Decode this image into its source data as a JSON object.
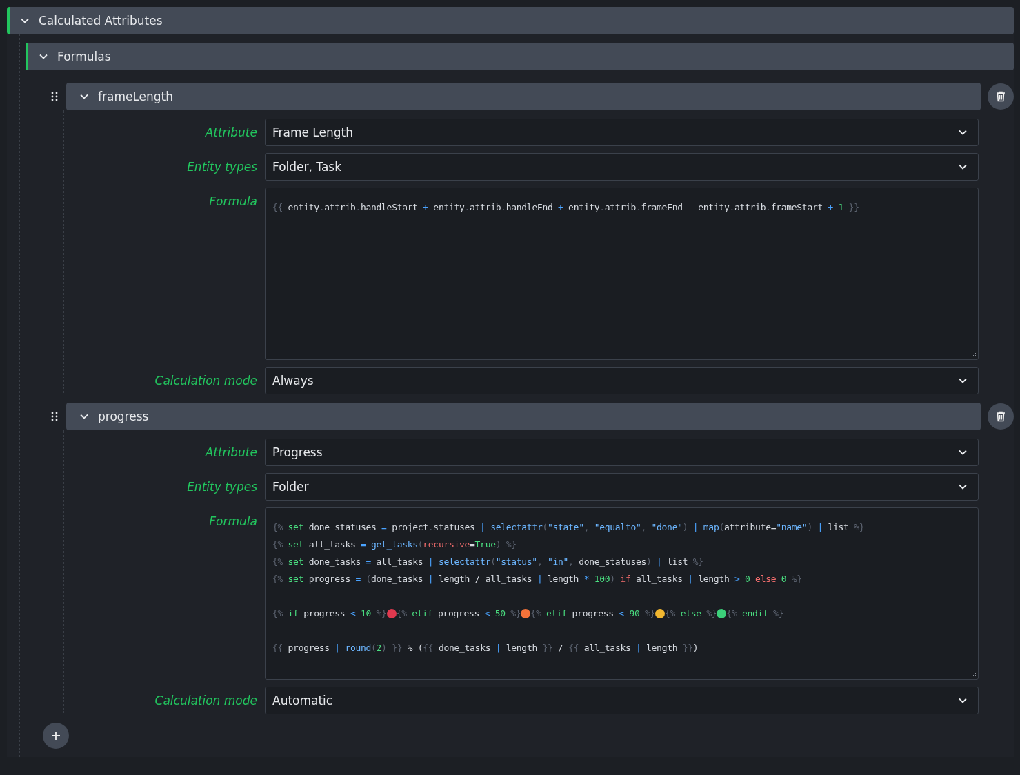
{
  "section": {
    "title": "Calculated Attributes",
    "expanded": true
  },
  "group": {
    "title": "Formulas",
    "expanded": true
  },
  "items": [
    {
      "name": "frameLength",
      "expanded": true,
      "fields": [
        {
          "label": "Attribute",
          "kind": "select",
          "value": "Frame Length"
        },
        {
          "label": "Entity types",
          "kind": "select",
          "value": "Folder, Task"
        },
        {
          "label": "Formula",
          "kind": "code",
          "lines": [
            {
              "space_before": false,
              "tokens": [
                {
                  "text": "{{",
                  "kind": "d"
                },
                {
                  "text": " entity",
                  "kind": "n"
                },
                {
                  "text": ".",
                  "kind": "d"
                },
                {
                  "text": "attrib",
                  "kind": "n"
                },
                {
                  "text": ".",
                  "kind": "d"
                },
                {
                  "text": "handleStart ",
                  "kind": "n"
                },
                {
                  "text": "+",
                  "kind": "o"
                },
                {
                  "text": " entity",
                  "kind": "n"
                },
                {
                  "text": ".",
                  "kind": "d"
                },
                {
                  "text": "attrib",
                  "kind": "n"
                },
                {
                  "text": ".",
                  "kind": "d"
                },
                {
                  "text": "handleEnd ",
                  "kind": "n"
                },
                {
                  "text": "+",
                  "kind": "o"
                },
                {
                  "text": " entity",
                  "kind": "n"
                },
                {
                  "text": ".",
                  "kind": "d"
                },
                {
                  "text": "attrib",
                  "kind": "n"
                },
                {
                  "text": ".",
                  "kind": "d"
                },
                {
                  "text": "frameEnd ",
                  "kind": "n"
                },
                {
                  "text": "-",
                  "kind": "o"
                },
                {
                  "text": " entity",
                  "kind": "n"
                },
                {
                  "text": ".",
                  "kind": "d"
                },
                {
                  "text": "attrib",
                  "kind": "n"
                },
                {
                  "text": ".",
                  "kind": "d"
                },
                {
                  "text": "frameStart ",
                  "kind": "n"
                },
                {
                  "text": "+",
                  "kind": "o"
                },
                {
                  "text": " 1",
                  "kind": "num"
                },
                {
                  "text": " }}",
                  "kind": "d"
                }
              ]
            }
          ]
        },
        {
          "label": "Calculation mode",
          "kind": "select",
          "value": "Always"
        }
      ]
    },
    {
      "name": "progress",
      "expanded": true,
      "fields": [
        {
          "label": "Attribute",
          "kind": "select",
          "value": "Progress"
        },
        {
          "label": "Entity types",
          "kind": "select",
          "value": "Folder"
        },
        {
          "label": "Formula",
          "kind": "code",
          "lines": [
            {
              "space_before": false,
              "tokens": [
                {
                  "text": "{%",
                  "kind": "d"
                },
                {
                  "text": " set",
                  "kind": "kw"
                },
                {
                  "text": " done_statuses ",
                  "kind": "n"
                },
                {
                  "text": "=",
                  "kind": "o"
                },
                {
                  "text": " project",
                  "kind": "n"
                },
                {
                  "text": ".",
                  "kind": "d"
                },
                {
                  "text": "statuses ",
                  "kind": "n"
                },
                {
                  "text": "|",
                  "kind": "o"
                },
                {
                  "text": " selectattr",
                  "kind": "f"
                },
                {
                  "text": "(",
                  "kind": "d"
                },
                {
                  "text": "\"state\"",
                  "kind": "s"
                },
                {
                  "text": ", ",
                  "kind": "d"
                },
                {
                  "text": "\"equalto\"",
                  "kind": "s"
                },
                {
                  "text": ", ",
                  "kind": "d"
                },
                {
                  "text": "\"done\"",
                  "kind": "s"
                },
                {
                  "text": ")",
                  "kind": "d"
                },
                {
                  "text": " | ",
                  "kind": "o"
                },
                {
                  "text": "map",
                  "kind": "f"
                },
                {
                  "text": "(",
                  "kind": "d"
                },
                {
                  "text": "attribute=",
                  "kind": "n"
                },
                {
                  "text": "\"name\"",
                  "kind": "s"
                },
                {
                  "text": ")",
                  "kind": "d"
                },
                {
                  "text": " | ",
                  "kind": "o"
                },
                {
                  "text": "list",
                  "kind": "n"
                },
                {
                  "text": " %}",
                  "kind": "d"
                }
              ]
            },
            {
              "space_before": false,
              "tokens": [
                {
                  "text": "{%",
                  "kind": "d"
                },
                {
                  "text": " set",
                  "kind": "kw"
                },
                {
                  "text": " all_tasks ",
                  "kind": "n"
                },
                {
                  "text": "=",
                  "kind": "o"
                },
                {
                  "text": " get_tasks",
                  "kind": "f"
                },
                {
                  "text": "(",
                  "kind": "d"
                },
                {
                  "text": "recursive",
                  "kind": "alt"
                },
                {
                  "text": "=",
                  "kind": "n"
                },
                {
                  "text": "True",
                  "kind": "kw"
                },
                {
                  "text": ")",
                  "kind": "d"
                },
                {
                  "text": " %}",
                  "kind": "d"
                }
              ]
            },
            {
              "space_before": false,
              "tokens": [
                {
                  "text": "{%",
                  "kind": "d"
                },
                {
                  "text": " set",
                  "kind": "kw"
                },
                {
                  "text": " done_tasks ",
                  "kind": "n"
                },
                {
                  "text": "=",
                  "kind": "o"
                },
                {
                  "text": " all_tasks ",
                  "kind": "n"
                },
                {
                  "text": "|",
                  "kind": "o"
                },
                {
                  "text": " selectattr",
                  "kind": "f"
                },
                {
                  "text": "(",
                  "kind": "d"
                },
                {
                  "text": "\"status\"",
                  "kind": "s"
                },
                {
                  "text": ", ",
                  "kind": "d"
                },
                {
                  "text": "\"in\"",
                  "kind": "s"
                },
                {
                  "text": ", ",
                  "kind": "d"
                },
                {
                  "text": "done_statuses",
                  "kind": "n"
                },
                {
                  "text": ")",
                  "kind": "d"
                },
                {
                  "text": " | ",
                  "kind": "o"
                },
                {
                  "text": "list",
                  "kind": "n"
                },
                {
                  "text": " %}",
                  "kind": "d"
                }
              ]
            },
            {
              "space_before": false,
              "tokens": [
                {
                  "text": "{%",
                  "kind": "d"
                },
                {
                  "text": " set",
                  "kind": "kw"
                },
                {
                  "text": " progress ",
                  "kind": "n"
                },
                {
                  "text": "=",
                  "kind": "o"
                },
                {
                  "text": " (",
                  "kind": "d"
                },
                {
                  "text": "done_tasks ",
                  "kind": "n"
                },
                {
                  "text": "|",
                  "kind": "o"
                },
                {
                  "text": " length / all_tasks ",
                  "kind": "n"
                },
                {
                  "text": "|",
                  "kind": "o"
                },
                {
                  "text": " length ",
                  "kind": "n"
                },
                {
                  "text": "*",
                  "kind": "o"
                },
                {
                  "text": " 100",
                  "kind": "num"
                },
                {
                  "text": ")",
                  "kind": "d"
                },
                {
                  "text": " if",
                  "kind": "alt"
                },
                {
                  "text": " all_tasks ",
                  "kind": "n"
                },
                {
                  "text": "|",
                  "kind": "o"
                },
                {
                  "text": " length ",
                  "kind": "n"
                },
                {
                  "text": ">",
                  "kind": "o"
                },
                {
                  "text": " 0",
                  "kind": "num"
                },
                {
                  "text": " else",
                  "kind": "alt"
                },
                {
                  "text": " 0",
                  "kind": "num"
                },
                {
                  "text": " %}",
                  "kind": "d"
                }
              ]
            },
            {
              "space_before": true,
              "tokens": [
                {
                  "text": "{%",
                  "kind": "d"
                },
                {
                  "text": " if",
                  "kind": "kw"
                },
                {
                  "text": " progress ",
                  "kind": "n"
                },
                {
                  "text": "<",
                  "kind": "o"
                },
                {
                  "text": " 10",
                  "kind": "num"
                },
                {
                  "text": " %}",
                  "kind": "d"
                },
                {
                  "kind": "dot",
                  "color": "#e0394f"
                },
                {
                  "text": "{%",
                  "kind": "d"
                },
                {
                  "text": " elif",
                  "kind": "kw"
                },
                {
                  "text": " progress ",
                  "kind": "n"
                },
                {
                  "text": "<",
                  "kind": "o"
                },
                {
                  "text": " 50",
                  "kind": "num"
                },
                {
                  "text": " %}",
                  "kind": "d"
                },
                {
                  "kind": "dot",
                  "color": "#f5733a"
                },
                {
                  "text": "{%",
                  "kind": "d"
                },
                {
                  "text": " elif",
                  "kind": "kw"
                },
                {
                  "text": " progress ",
                  "kind": "n"
                },
                {
                  "text": "<",
                  "kind": "o"
                },
                {
                  "text": " 90",
                  "kind": "num"
                },
                {
                  "text": " %}",
                  "kind": "d"
                },
                {
                  "kind": "dot",
                  "color": "#f2b730"
                },
                {
                  "text": "{%",
                  "kind": "d"
                },
                {
                  "text": " else",
                  "kind": "kw"
                },
                {
                  "text": " %}",
                  "kind": "d"
                },
                {
                  "kind": "dot",
                  "color": "#3ccf7a"
                },
                {
                  "text": "{%",
                  "kind": "d"
                },
                {
                  "text": " endif",
                  "kind": "kw"
                },
                {
                  "text": " %}",
                  "kind": "d"
                }
              ]
            },
            {
              "space_before": true,
              "tokens": [
                {
                  "text": "{{",
                  "kind": "d"
                },
                {
                  "text": " progress ",
                  "kind": "n"
                },
                {
                  "text": "|",
                  "kind": "o"
                },
                {
                  "text": " round",
                  "kind": "f"
                },
                {
                  "text": "(",
                  "kind": "d"
                },
                {
                  "text": "2",
                  "kind": "num"
                },
                {
                  "text": ")",
                  "kind": "d"
                },
                {
                  "text": " }}",
                  "kind": "d"
                },
                {
                  "text": " % (",
                  "kind": "n"
                },
                {
                  "text": "{{",
                  "kind": "d"
                },
                {
                  "text": " done_tasks ",
                  "kind": "n"
                },
                {
                  "text": "|",
                  "kind": "o"
                },
                {
                  "text": " length ",
                  "kind": "n"
                },
                {
                  "text": "}}",
                  "kind": "d"
                },
                {
                  "text": " / ",
                  "kind": "n"
                },
                {
                  "text": "{{",
                  "kind": "d"
                },
                {
                  "text": " all_tasks ",
                  "kind": "n"
                },
                {
                  "text": "|",
                  "kind": "o"
                },
                {
                  "text": " length ",
                  "kind": "n"
                },
                {
                  "text": "}}",
                  "kind": "d"
                },
                {
                  "text": ")",
                  "kind": "n"
                }
              ]
            }
          ]
        },
        {
          "label": "Calculation mode",
          "kind": "select",
          "value": "Automatic"
        }
      ]
    }
  ]
}
